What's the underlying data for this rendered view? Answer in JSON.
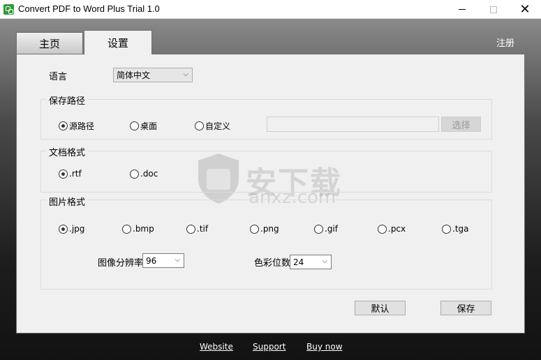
{
  "window": {
    "title": "Convert PDF to Word Plus Trial 1.0",
    "minimize": "",
    "maximize": "",
    "close": "✕"
  },
  "tabs": {
    "home": "主页",
    "settings": "设置",
    "register": "注册"
  },
  "language": {
    "label": "语言",
    "value": "简体中文"
  },
  "save_path": {
    "title": "保存路径",
    "options": [
      "源路径",
      "桌面",
      "自定义"
    ],
    "selected": "源路径",
    "custom_path_value": "",
    "browse_button": "选择"
  },
  "doc_format": {
    "title": "文档格式",
    "options": [
      ".rtf",
      ".doc"
    ],
    "selected": ".rtf"
  },
  "image_format": {
    "title": "图片格式",
    "options": [
      ".jpg",
      ".bmp",
      ".tif",
      ".png",
      ".gif",
      ".pcx",
      ".tga"
    ],
    "selected": ".jpg",
    "resolution_label": "图像分辨率",
    "resolution_value": "96",
    "color_depth_label": "色彩位数",
    "color_depth_value": "24"
  },
  "buttons": {
    "default": "默认",
    "save": "保存"
  },
  "watermark": {
    "brand": "安下载",
    "domain": "anxz.com"
  },
  "footer": {
    "website": "Website",
    "support": "Support",
    "buy_now": "Buy now"
  }
}
